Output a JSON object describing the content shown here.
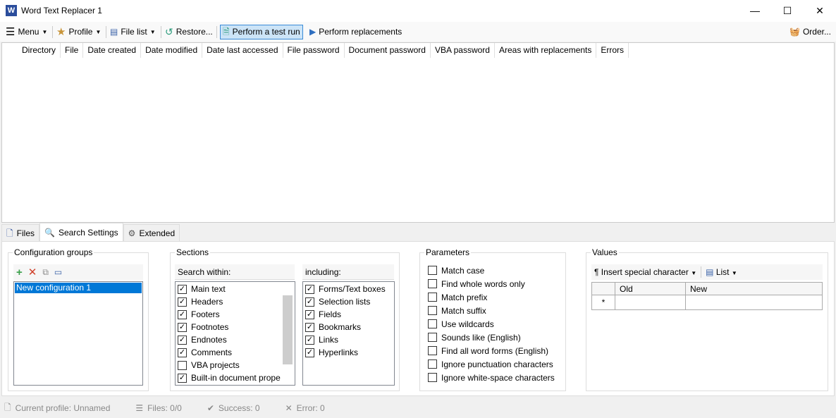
{
  "window": {
    "title": "Word Text Replacer 1",
    "minimize": "—",
    "maximize": "☐",
    "close": "✕"
  },
  "toolbar": {
    "menu": "Menu",
    "profile": "Profile",
    "file_list": "File list",
    "restore": "Restore...",
    "test_run": "Perform a test run",
    "replace": "Perform replacements",
    "order": "Order..."
  },
  "grid": {
    "columns": [
      "Directory",
      "File",
      "Date created",
      "Date modified",
      "Date last accessed",
      "File password",
      "Document password",
      "VBA password",
      "Areas with replacements",
      "Errors"
    ]
  },
  "tabs": [
    "Files",
    "Search Settings",
    "Extended"
  ],
  "config": {
    "legend": "Configuration groups",
    "items": [
      "New configuration 1"
    ]
  },
  "sections": {
    "legend": "Sections",
    "search_within": "Search within:",
    "including": "including:",
    "within_items": [
      {
        "label": "Main text",
        "checked": true
      },
      {
        "label": "Headers",
        "checked": true
      },
      {
        "label": "Footers",
        "checked": true
      },
      {
        "label": "Footnotes",
        "checked": true
      },
      {
        "label": "Endnotes",
        "checked": true
      },
      {
        "label": "Comments",
        "checked": true
      },
      {
        "label": "VBA projects",
        "checked": false
      },
      {
        "label": "Built-in document prope",
        "checked": true
      }
    ],
    "including_items": [
      {
        "label": "Forms/Text boxes",
        "checked": true
      },
      {
        "label": "Selection lists",
        "checked": true
      },
      {
        "label": "Fields",
        "checked": true
      },
      {
        "label": "Bookmarks",
        "checked": true
      },
      {
        "label": "Links",
        "checked": true
      },
      {
        "label": "Hyperlinks",
        "checked": true
      }
    ]
  },
  "parameters": {
    "legend": "Parameters",
    "items": [
      "Match case",
      "Find whole words only",
      "Match prefix",
      "Match suffix",
      "Use wildcards",
      "Sounds like (English)",
      "Find all word forms (English)",
      "Ignore punctuation characters",
      "Ignore white-space characters"
    ]
  },
  "values": {
    "legend": "Values",
    "insert_special": "Insert special character",
    "list": "List",
    "col_old": "Old",
    "col_new": "New",
    "new_row_marker": "*"
  },
  "status": {
    "profile": "Current profile: Unnamed",
    "files": "Files: 0/0",
    "success": "Success: 0",
    "error": "Error: 0"
  }
}
